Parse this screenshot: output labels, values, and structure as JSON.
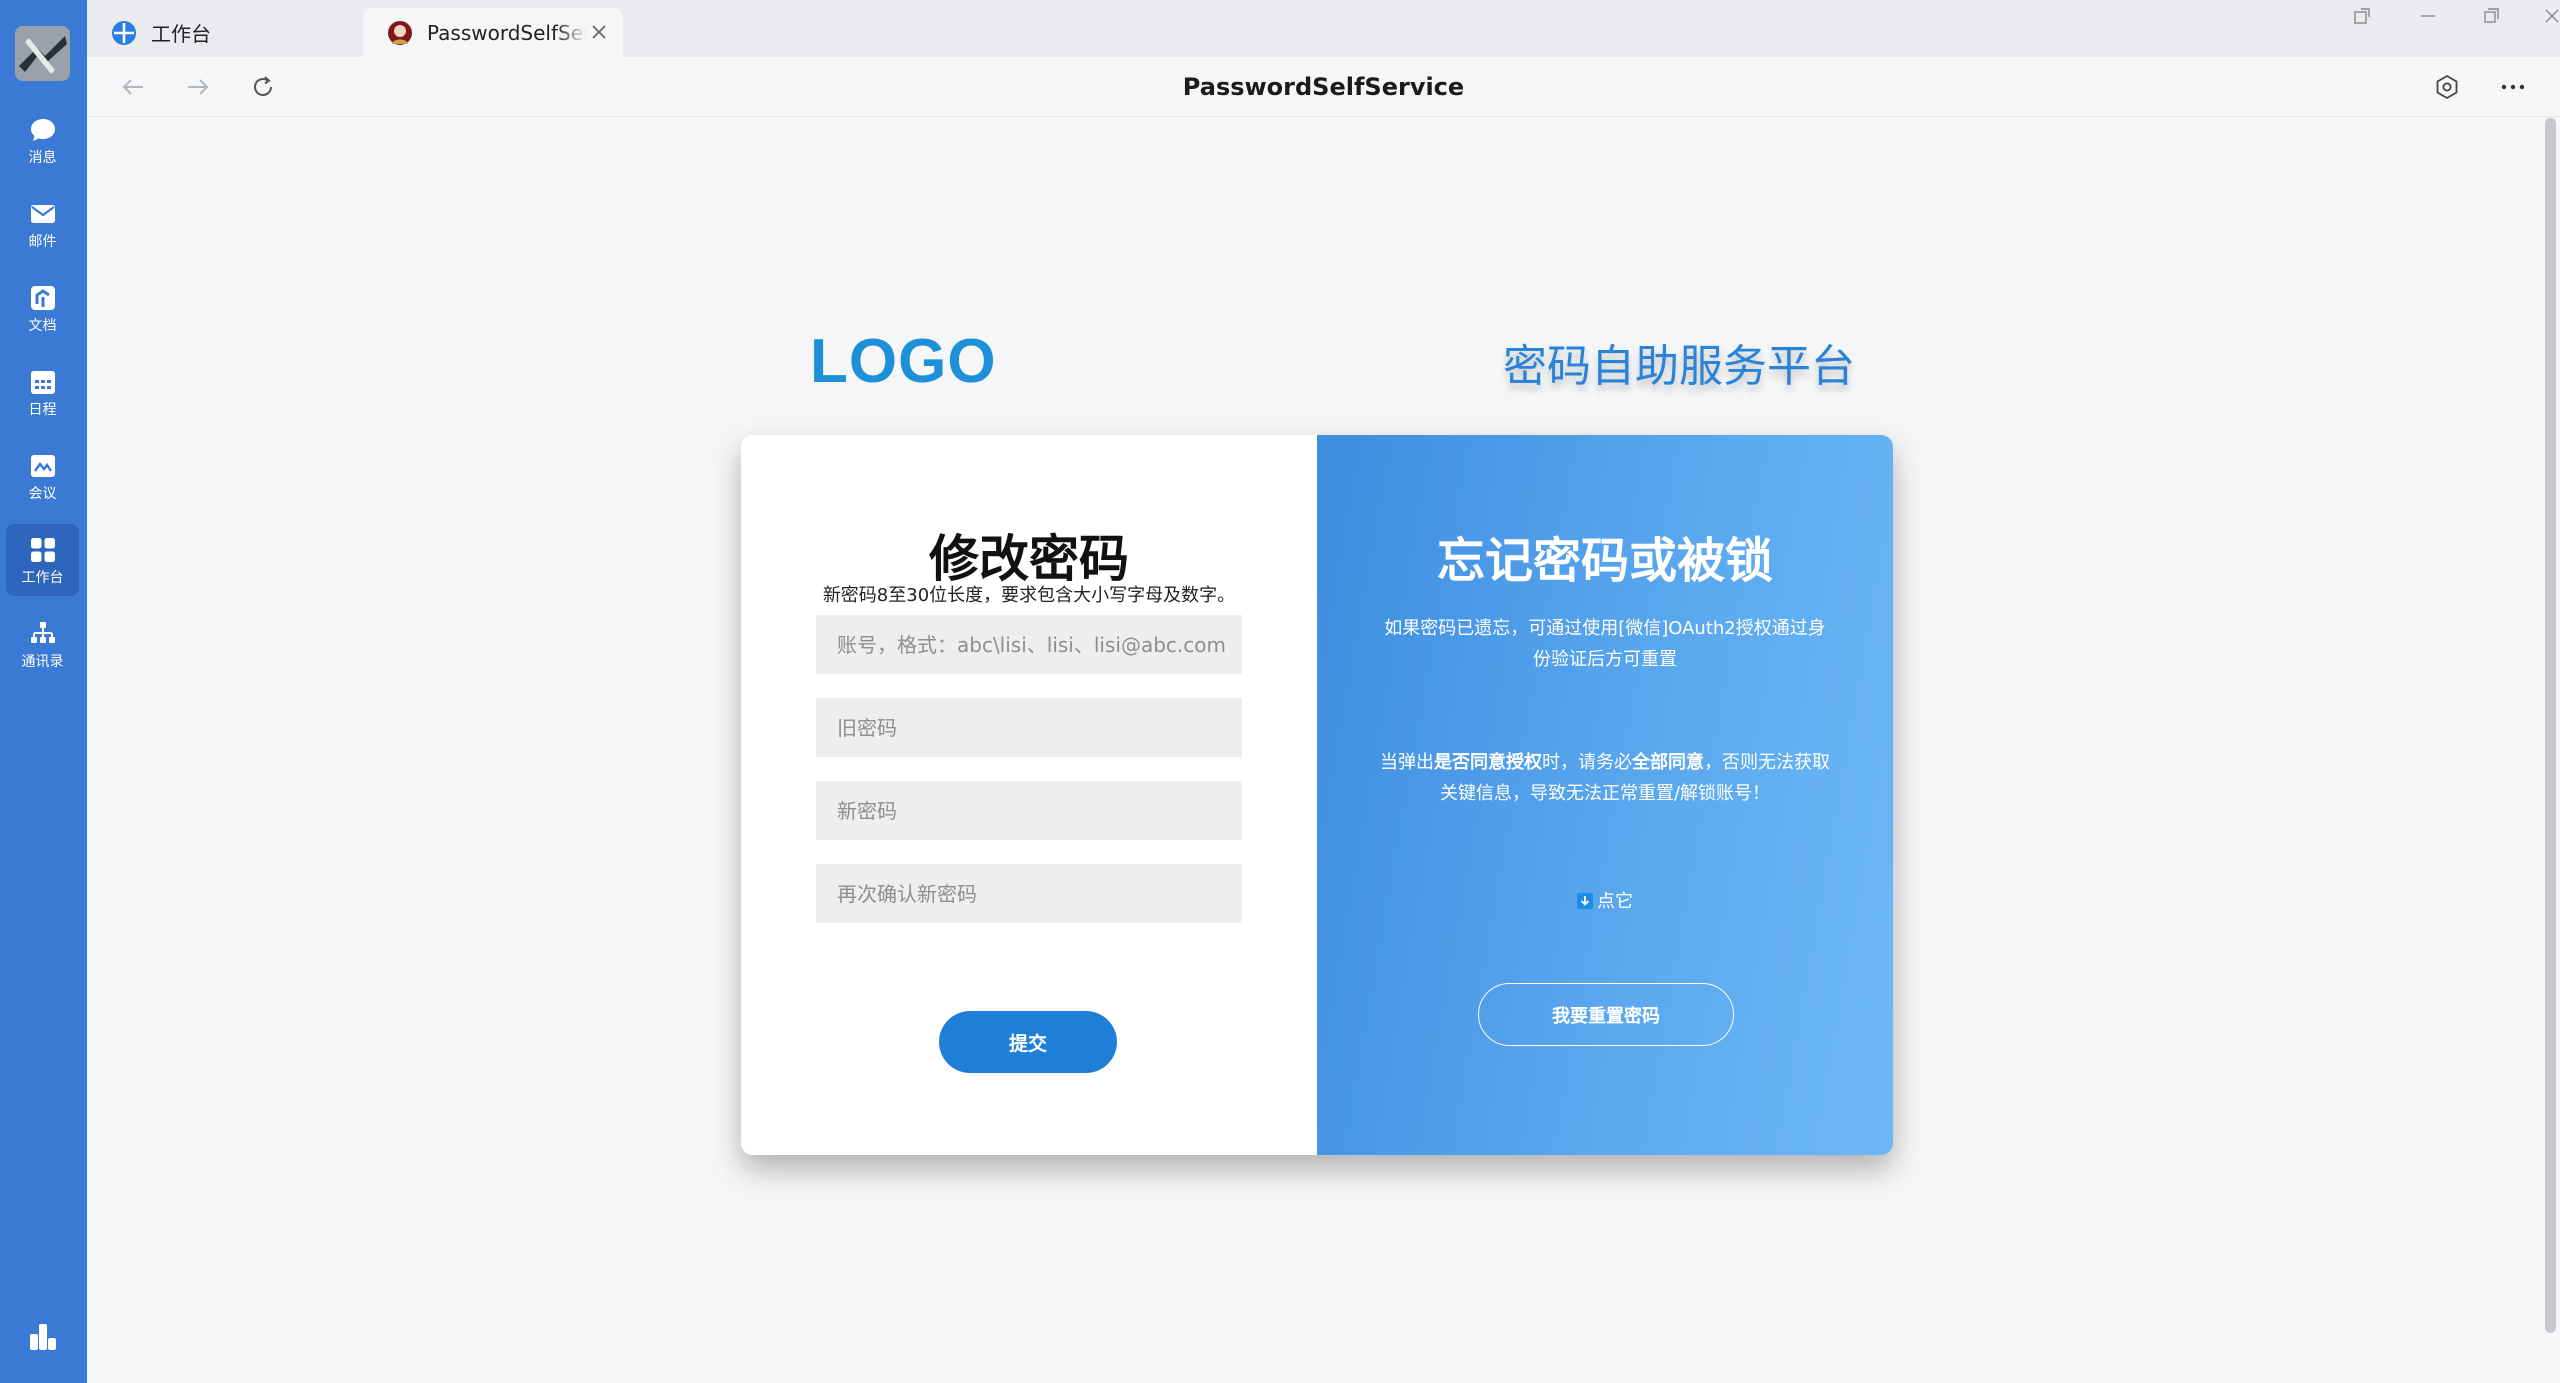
{
  "rail": {
    "items": [
      {
        "label": "消息",
        "icon": "chat-bubble-icon"
      },
      {
        "label": "邮件",
        "icon": "mail-icon"
      },
      {
        "label": "文档",
        "icon": "document-icon"
      },
      {
        "label": "日程",
        "icon": "calendar-icon"
      },
      {
        "label": "会议",
        "icon": "meeting-icon"
      },
      {
        "label": "工作台",
        "icon": "grid-icon"
      },
      {
        "label": "通讯录",
        "icon": "org-chart-icon"
      }
    ],
    "active": "工作台"
  },
  "tabs": [
    {
      "title": "工作台"
    },
    {
      "title": "PasswordSelfService"
    }
  ],
  "toolbar": {
    "title": "PasswordSelfService"
  },
  "page": {
    "logo": "LOGO",
    "platform_title": "密码自助服务平台"
  },
  "change_password": {
    "heading": "修改密码",
    "hint": "新密码8至30位长度，要求包含大小写字母及数字。",
    "account_placeholder": "账号，格式：abc\\lisi、lisi、lisi@abc.com",
    "old_password_placeholder": "旧密码",
    "new_password_placeholder": "新密码",
    "confirm_password_placeholder": "再次确认新密码",
    "submit_label": "提交"
  },
  "forgot": {
    "heading": "忘记密码或被锁",
    "desc": "如果密码已遗忘，可通过使用[微信]OAuth2授权通过身份验证后方可重置",
    "warn_pre": "当弹出",
    "warn_bold1": "是否同意授权",
    "warn_mid": "时，请务必",
    "warn_bold2": "全部同意",
    "warn_post": "，否则无法获取关键信息，导致无法正常重置/解锁账号！",
    "click_label": "点它",
    "reset_label": "我要重置密码"
  },
  "colors": {
    "rail": "#3a7ad4",
    "accent": "#1e7fd8",
    "panel_gradient_start": "#3d8de0",
    "panel_gradient_end": "#6cb8f6"
  }
}
